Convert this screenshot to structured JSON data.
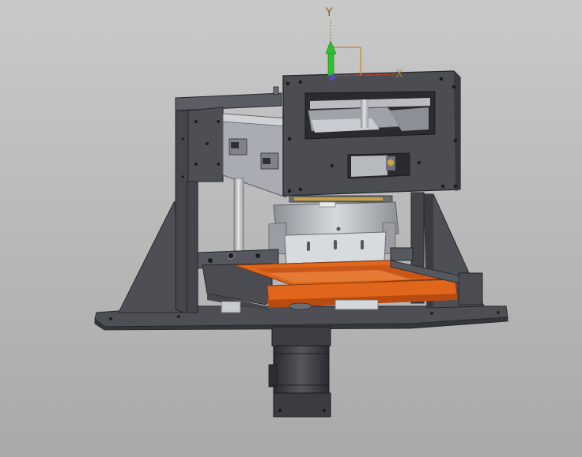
{
  "viewport": {
    "background_top": "#c9c9c9",
    "background_bottom": "#a9a9a9"
  },
  "triad": {
    "y_label": "Y",
    "x_label": "X",
    "y_color": "#2fbf2f",
    "x_color": "#d0402a",
    "frame_color": "#c58a3a"
  },
  "model": {
    "frame_color": "#4d4f55",
    "frame_dark": "#34363b",
    "frame_light": "#6a6d73",
    "steel_color": "#b8bcc2",
    "steel_dark": "#8d9197",
    "tray_color": "#e0661c",
    "tray_dark": "#b84c10",
    "motor_color": "#3c3e43",
    "motor_dark": "#26272b"
  }
}
